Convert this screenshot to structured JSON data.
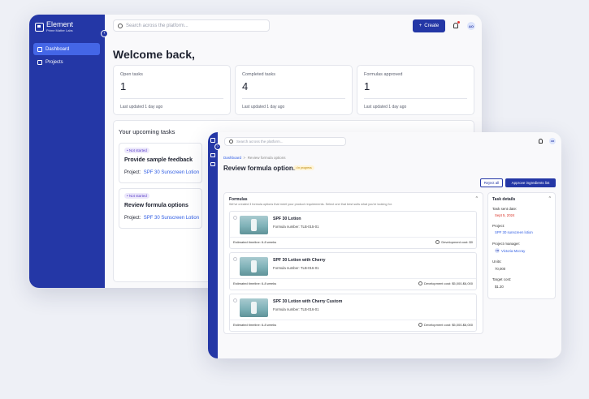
{
  "dashboard": {
    "logo": {
      "name": "Element",
      "tagline": "Prime Matter Labs"
    },
    "collapse_glyph": "‹",
    "nav": [
      {
        "label": "Dashboard",
        "icon": "dashboard-icon",
        "active": true
      },
      {
        "label": "Projects",
        "icon": "projects-icon",
        "active": false
      }
    ],
    "search_placeholder": "Search across the platform...",
    "create_label": "Create",
    "create_glyph": "+",
    "avatar": "AO",
    "welcome": "Welcome back,",
    "stats": [
      {
        "label": "Open tasks",
        "value": "1",
        "updated": "Last updated 1 day ago"
      },
      {
        "label": "Completed tasks",
        "value": "4",
        "updated": "Last updated 1 day ago"
      },
      {
        "label": "Formulas approved",
        "value": "1",
        "updated": "Last updated 1 day ago"
      }
    ],
    "upcoming_title": "Your upcoming tasks",
    "tasks": [
      {
        "status": "Not started",
        "title": "Provide sample feedback",
        "project_label": "Project:",
        "project": "SPF 30 Sunscreen Lotion"
      },
      {
        "status": "Not started",
        "title": "Review formula options",
        "project_label": "Project:",
        "project": "SPF 30 Sunscreen Lotion"
      }
    ]
  },
  "review": {
    "collapse_glyph": "›",
    "search_placeholder": "Search across the platform...",
    "avatar": "AO",
    "breadcrumb": {
      "root": "Dashboard",
      "sep": ">",
      "current": "Review formula options"
    },
    "title": "Review formula options",
    "status": "In progress",
    "reject_label": "Reject all",
    "approve_label": "Approve ingredients list",
    "formulas_title": "Formulas",
    "formulas_desc": "We've created 3 formula options that meet your product requirements. Select one that best suits what you're looking for.",
    "chevron": "^",
    "formulas": [
      {
        "name": "SPF 30 Lotion",
        "number": "Formula number: TLB-015-01",
        "timeline": "Estimated timeline: 6-8 weeks",
        "cost": "Development cost: $0"
      },
      {
        "name": "SPF 30 Lotion with Cherry",
        "number": "Formula number: TLB-016-01",
        "timeline": "Estimated timeline: 6-8 weeks",
        "cost": "Development cost: $5,000-$6,000"
      },
      {
        "name": "SPF 30 Lotion with Cherry Custom",
        "number": "Formula number: TLB-016-01",
        "timeline": "Estimated timeline: 6-8 weeks",
        "cost": "Development cost: $5,000-$6,000"
      }
    ],
    "details": {
      "title": "Task details",
      "items": [
        {
          "label": "Task sent date:",
          "value": "Sept 5, 2024",
          "color": "#d93025"
        },
        {
          "label": "Project:",
          "value": "SPF 30 sunscreen lotion",
          "color": "#2d5be3"
        },
        {
          "label": "Project manager:",
          "value": "Victoria Mccray",
          "initials": "VM",
          "color": "#2d5be3"
        },
        {
          "label": "Units:",
          "value": "70,000",
          "color": "#333333"
        },
        {
          "label": "Target cost:",
          "value": "$1.20",
          "color": "#333333"
        }
      ]
    }
  },
  "colors": {
    "brand": "#2437a6",
    "link": "#2d5be3",
    "nav_active": "#4466e6"
  }
}
